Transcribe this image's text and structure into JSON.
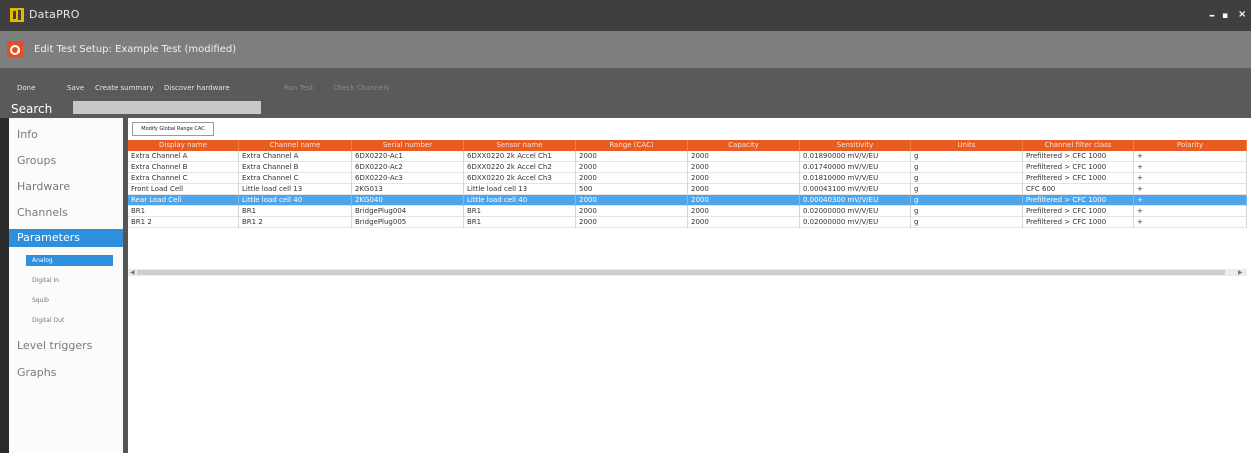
{
  "window": {
    "title": "DataPRO",
    "controls": {
      "minimize": "–",
      "maximize": "▪",
      "close": "×"
    }
  },
  "header": {
    "title": "Edit Test Setup: Example Test  (modified)",
    "icon": "settings-gear-icon"
  },
  "toolbar": {
    "items": [
      {
        "label": "Done",
        "enabled": true
      },
      {
        "label": "Save",
        "enabled": true
      },
      {
        "label": "Create summary",
        "enabled": true
      },
      {
        "label": "Discover hardware",
        "enabled": true
      },
      {
        "label": "Run Test",
        "enabled": false
      },
      {
        "label": "Check Channels",
        "enabled": false
      }
    ],
    "search": {
      "label": "Search",
      "value": "",
      "placeholder": ""
    }
  },
  "sidebar": {
    "items": [
      {
        "label": "Info",
        "active": false
      },
      {
        "label": "Groups",
        "active": false
      },
      {
        "label": "Hardware",
        "active": false
      },
      {
        "label": "Channels",
        "active": false
      },
      {
        "label": "Parameters",
        "active": true
      },
      {
        "label": "Level triggers",
        "active": false
      },
      {
        "label": "Graphs",
        "active": false
      }
    ],
    "subitems": [
      {
        "label": "Analog",
        "active": true
      },
      {
        "label": "Digital In",
        "active": false
      },
      {
        "label": "Squib",
        "active": false
      },
      {
        "label": "Digital Out",
        "active": false
      }
    ]
  },
  "main": {
    "global_button": "Modify Global Range CAC",
    "columns": [
      "Display name",
      "Channel name",
      "Serial number",
      "Sensor name",
      "Range (CAC)",
      "Capacity",
      "Sensitivity",
      "Units",
      "Channel filter class",
      "Polarity"
    ],
    "rows": [
      [
        "Extra Channel A",
        "Extra Channel A",
        "6DX0220-Ac1",
        "6DXX0220 2k Accel Ch1",
        "2000",
        "2000",
        "0.01890000 mV/V/EU",
        "g",
        "Prefiltered > CFC 1000",
        "+"
      ],
      [
        "Extra Channel B",
        "Extra Channel B",
        "6DX0220-Ac2",
        "6DXX0220 2k Accel Ch2",
        "2000",
        "2000",
        "0.01740000 mV/V/EU",
        "g",
        "Prefiltered > CFC 1000",
        "+"
      ],
      [
        "Extra Channel C",
        "Extra Channel C",
        "6DX0220-Ac3",
        "6DXX0220 2k Accel Ch3",
        "2000",
        "2000",
        "0.01810000 mV/V/EU",
        "g",
        "Prefiltered > CFC 1000",
        "+"
      ],
      [
        "Front Load Cell",
        "Little load cell 13",
        "2KG013",
        "Little load cell 13",
        "500",
        "2000",
        "0.00043100 mV/V/EU",
        "g",
        "CFC 600",
        "+"
      ],
      [
        "Rear Load Cell",
        "Little load cell 40",
        "2KG040",
        "Little load cell 40",
        "2000",
        "2000",
        "0.00040300 mV/V/EU",
        "g",
        "Prefiltered > CFC 1000",
        "+"
      ],
      [
        "BR1",
        "BR1",
        "BridgePlug004",
        "BR1",
        "2000",
        "2000",
        "0.02000000 mV/V/EU",
        "g",
        "Prefiltered > CFC 1000",
        "+"
      ],
      [
        "BR1 2",
        "BR1 2",
        "BridgePlug005",
        "BR1",
        "2000",
        "2000",
        "0.02000000 mV/V/EU",
        "g",
        "Prefiltered > CFC 1000",
        "+"
      ]
    ],
    "selected_row": 4
  },
  "colors": {
    "accent": "#2f8fdc",
    "grid_header": "#ea5b22",
    "selected_row": "#4ea5ec"
  }
}
